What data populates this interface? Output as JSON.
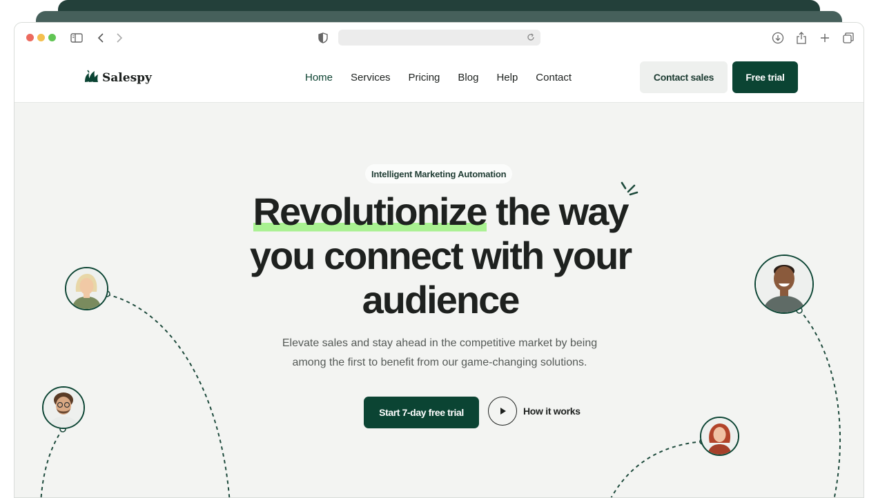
{
  "browser": {
    "traffic_lights": [
      "#ec6a5e",
      "#f4bf4f",
      "#61c554"
    ],
    "icons": [
      "sidebar-icon",
      "back-icon",
      "forward-icon",
      "shield-icon",
      "reload-icon",
      "download-icon",
      "share-icon",
      "new-tab-icon",
      "tabs-overview-icon"
    ],
    "url": ""
  },
  "brand": {
    "name": "Salespy",
    "color": "#0b4433",
    "accent": "#a9f191"
  },
  "nav": {
    "links": [
      "Home",
      "Services",
      "Pricing",
      "Blog",
      "Help",
      "Contact"
    ],
    "active": "Home",
    "contact_label": "Contact sales",
    "trial_label": "Free trial"
  },
  "hero": {
    "tag": "Intelligent Marketing Automation",
    "headline_highlight": "Revolutionize",
    "headline_rest1": " the way",
    "headline_line2": "you connect with your",
    "headline_line3": "audience",
    "subtitle": "Elevate sales and stay ahead in the competitive market by being among the first to benefit from our game-changing solutions.",
    "cta_primary": "Start 7-day free trial",
    "cta_secondary": "How it works"
  }
}
